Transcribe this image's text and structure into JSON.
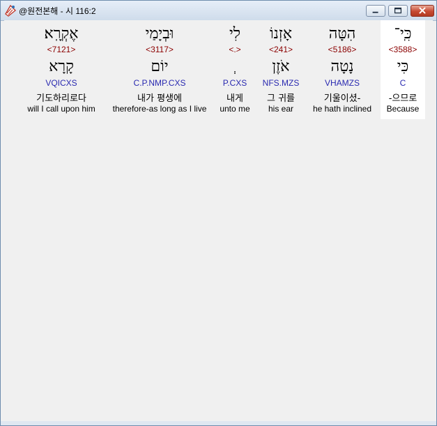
{
  "window": {
    "title": "@원전본해 - 시 116:2"
  },
  "words": [
    {
      "hebrew": "כִּֽי־",
      "strong": "<3588>",
      "lemma": "כִּי",
      "parse": "C",
      "korean": "-으므로",
      "english": "Because",
      "highlighted": true
    },
    {
      "hebrew": "הִטָּה",
      "strong": "<5186>",
      "lemma": "נָטָה",
      "parse": "VHAMZS",
      "korean": "기울이셨-",
      "english": "he hath inclined",
      "highlighted": false
    },
    {
      "hebrew": "אָזְנוֹ",
      "strong": "<241>",
      "lemma": "אֹזֶן",
      "parse": "NFS.MZS",
      "korean": "그 귀를",
      "english": "his ear",
      "highlighted": false
    },
    {
      "hebrew": "לִי",
      "strong": "<.>",
      "lemma": "ְ",
      "parse": "P.CXS",
      "korean": "내게",
      "english": "unto me",
      "highlighted": false
    },
    {
      "hebrew": "וּבְיָמַי",
      "strong": "<3117>",
      "lemma": "יוֹם",
      "parse": "C.P.NMP.CXS",
      "korean": "내가 평생에",
      "english": "therefore-as long as I live",
      "highlighted": false
    },
    {
      "hebrew": "אֶקְרָֽא׃",
      "strong": "<7121>",
      "lemma": "קָרָא",
      "parse": "VQICXS",
      "korean": "기도하리로다",
      "english": "will I call upon him",
      "highlighted": false
    }
  ]
}
